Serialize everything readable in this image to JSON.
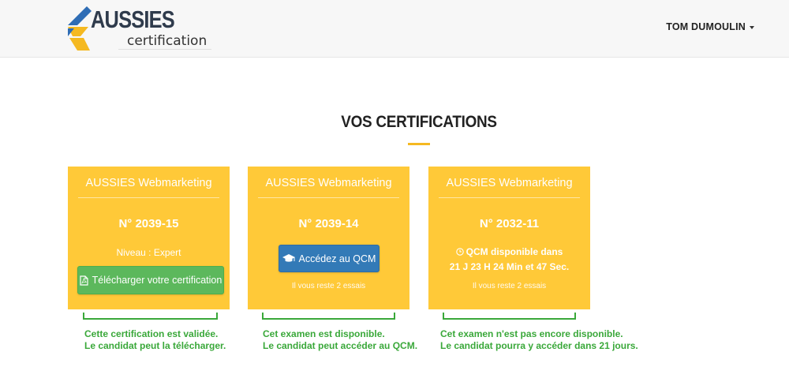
{
  "header": {
    "logo_title": "AUSSIES",
    "logo_subtitle": "certification",
    "user_name": "TOM DUMOULIN"
  },
  "page": {
    "title": "VOS CERTIFICATIONS"
  },
  "cards": [
    {
      "program": "AUSSIES Webmarketing",
      "number": "N° 2039-15",
      "level": "Niveau : Expert",
      "button_label": "Télécharger votre certification",
      "button_icon": "pdf-file-icon"
    },
    {
      "program": "AUSSIES Webmarketing",
      "number": "N° 2039-14",
      "button_label": "Accédez au QCM",
      "button_icon": "graduation-cap-icon",
      "remaining": "Il vous reste 2 essais"
    },
    {
      "program": "AUSSIES Webmarketing",
      "number": "N° 2032-11",
      "availability_line1": "QCM disponible dans",
      "availability_line2": "21 J 23 H 24 Min et 47 Sec.",
      "availability_icon": "clock-icon",
      "remaining": "Il vous reste 2 essais"
    }
  ],
  "annotations": [
    {
      "line1": "Cette certification est validée.",
      "line2": "Le candidat peut la télécharger."
    },
    {
      "line1": "Cet examen est disponible.",
      "line2": "Le candidat peut accéder au QCM."
    },
    {
      "line1": "Cet examen n'est pas encore disponible.",
      "line2": "Le candidat pourra y accéder dans 21 jours."
    }
  ],
  "colors": {
    "card": "#ffc938",
    "accent": "#f5b921",
    "success": "#5cb85c",
    "primary": "#337ab7",
    "annotation": "#3aa83a"
  }
}
